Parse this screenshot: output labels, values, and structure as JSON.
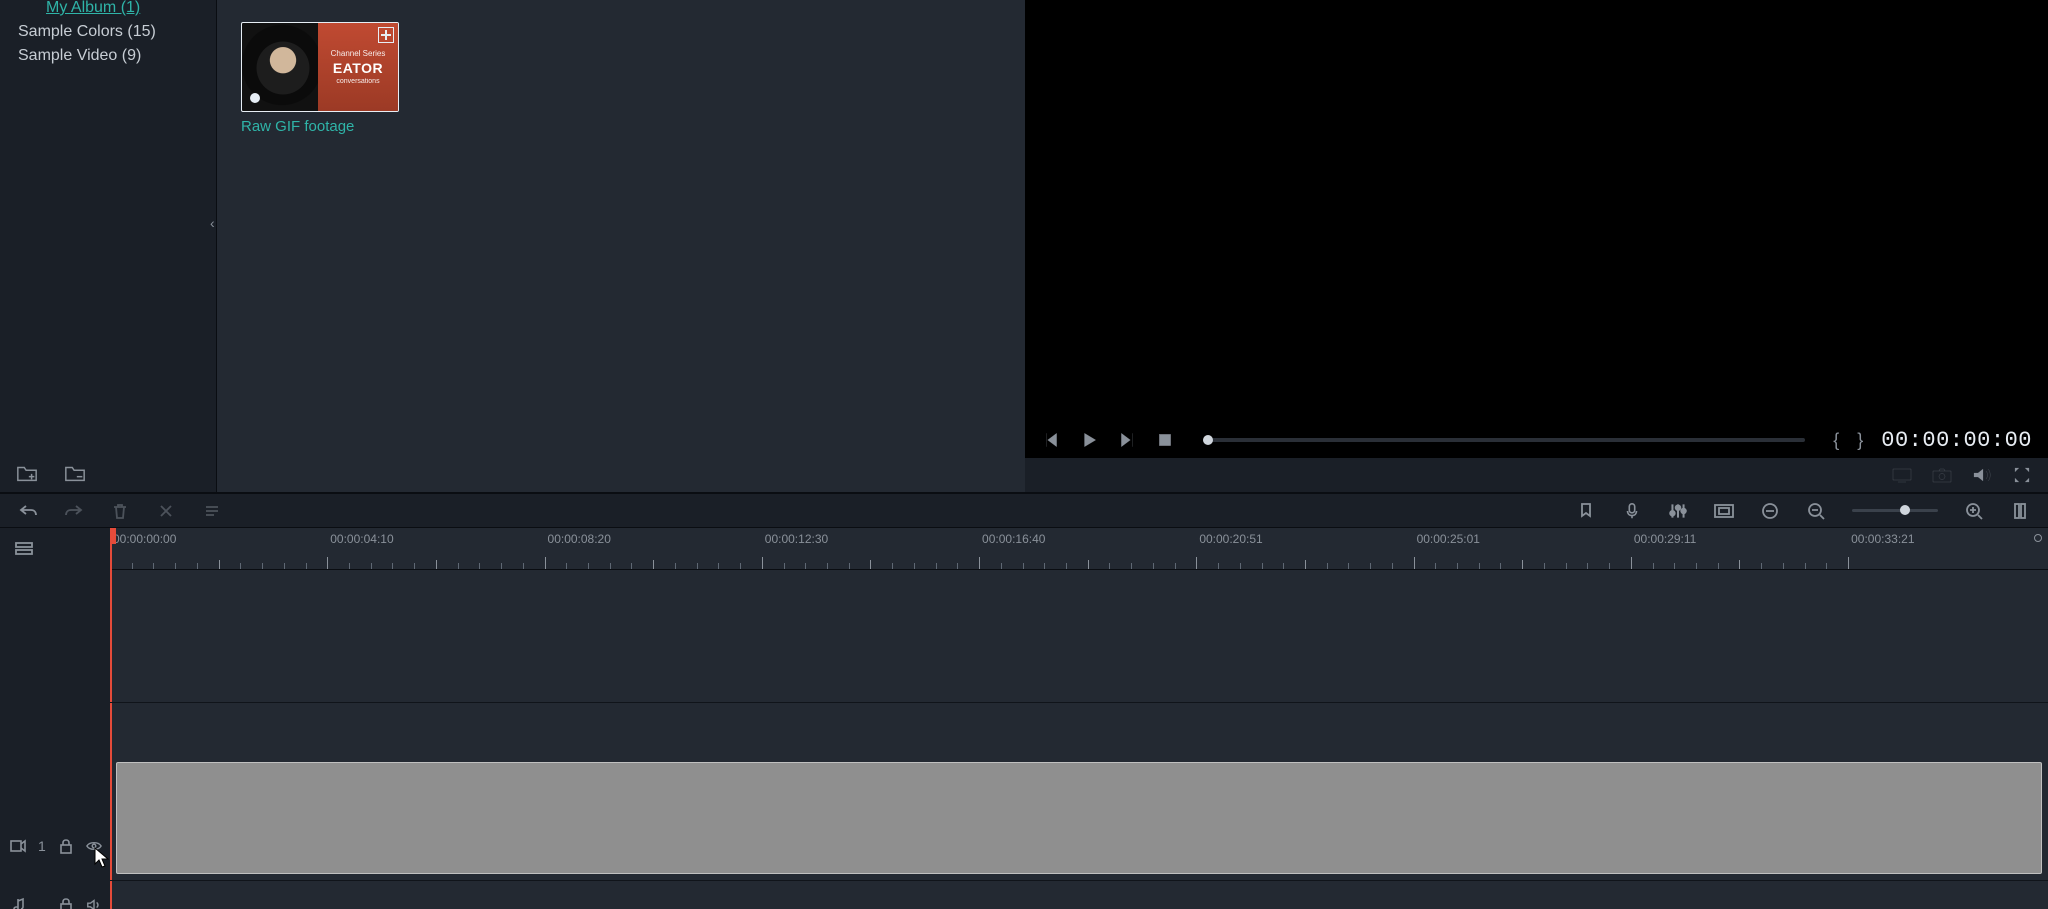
{
  "sidebar": {
    "items": [
      {
        "label": "My Album (1)",
        "active": true
      },
      {
        "label": "Sample Colors (15)",
        "active": false
      },
      {
        "label": "Sample Video (9)",
        "active": false
      }
    ]
  },
  "media": {
    "clip_label": "Raw GIF footage",
    "thumb_brand_top": "Channel Series",
    "thumb_brand_mid": "EATOR",
    "thumb_brand_bot": "conversations"
  },
  "transport": {
    "timecode": "00:00:00:00"
  },
  "ruler": {
    "labels": [
      "00:00:00:00",
      "00:00:04:10",
      "00:00:08:20",
      "00:00:12:30",
      "00:00:16:40",
      "00:00:20:51",
      "00:00:25:01",
      "00:00:29:11",
      "00:00:33:21"
    ]
  },
  "track": {
    "number": "1"
  }
}
